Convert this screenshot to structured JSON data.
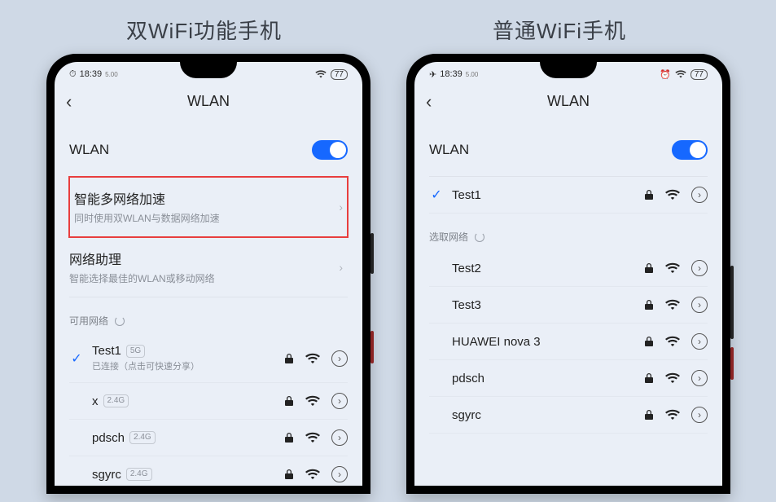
{
  "titles": {
    "left": "双WiFi功能手机",
    "right": "普通WiFi手机"
  },
  "status": {
    "left": {
      "prefix": "⏱",
      "time": "18:39",
      "sub": "5.00",
      "battPct": "77"
    },
    "right": {
      "prefix": "✈",
      "time": "18:39",
      "sub": "5.00",
      "alarm": "⏰",
      "battPct": "77"
    }
  },
  "nav": {
    "title": "WLAN"
  },
  "leftPhone": {
    "wlanLabel": "WLAN",
    "smartAccel": {
      "title": "智能多网络加速",
      "sub": "同时使用双WLAN与数据网络加速"
    },
    "netAssist": {
      "title": "网络助理",
      "sub": "智能选择最佳的WLAN或移动网络"
    },
    "groupLabel": "可用网络",
    "networks": [
      {
        "name": "Test1",
        "badge": "5G",
        "sub": "已连接（点击可快速分享）",
        "connected": true,
        "locked": true,
        "signal": 3
      },
      {
        "name": "x",
        "badge": "2.4G",
        "sub": "",
        "connected": false,
        "locked": true,
        "signal": 3
      },
      {
        "name": "pdsch",
        "badge": "2.4G",
        "sub": "",
        "connected": false,
        "locked": true,
        "signal": 3
      },
      {
        "name": "sgyrc",
        "badge": "2.4G",
        "sub": "",
        "connected": false,
        "locked": true,
        "signal": 3
      }
    ]
  },
  "rightPhone": {
    "wlanLabel": "WLAN",
    "connected": {
      "name": "Test1",
      "locked": true,
      "signal": 3
    },
    "groupLabel": "选取网络",
    "networks": [
      {
        "name": "Test2",
        "locked": true,
        "signal": 3
      },
      {
        "name": "Test3",
        "locked": true,
        "signal": 3
      },
      {
        "name": "HUAWEI nova 3",
        "locked": true,
        "signal": 3
      },
      {
        "name": "pdsch",
        "locked": true,
        "signal": 3
      },
      {
        "name": "sgyrc",
        "locked": true,
        "signal": 3
      }
    ]
  },
  "glyphs": {
    "info": "›"
  }
}
